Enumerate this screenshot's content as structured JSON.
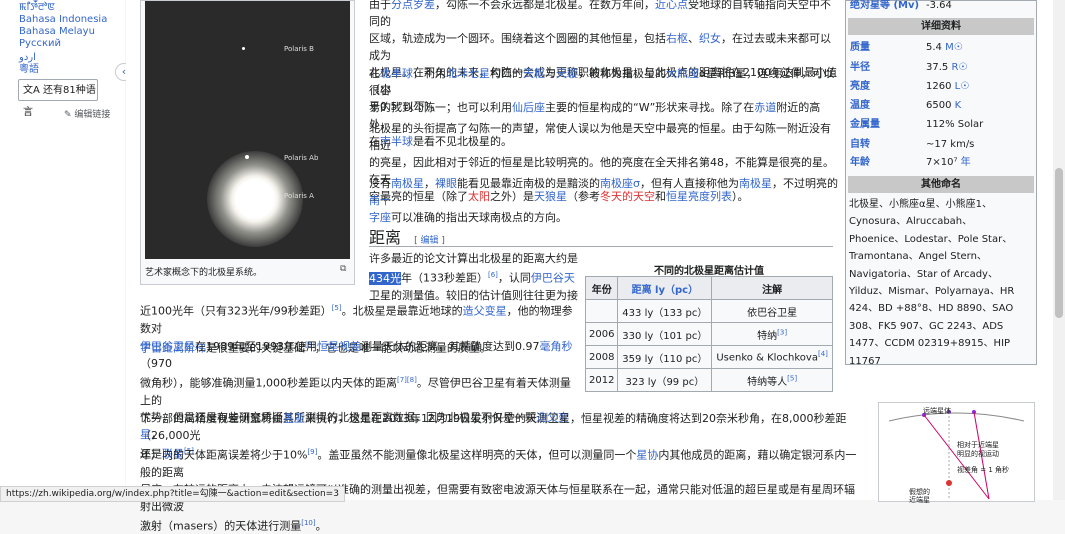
{
  "sidebar": {
    "languages": [
      "ꯃꯤꯇꯩꯂꯣꯟ",
      "Bahasa Indonesia",
      "Bahasa Melayu",
      "Русский",
      "اردو",
      "粵語"
    ],
    "more_languages": "还有81种语言",
    "edit_links": "编辑链接"
  },
  "thumb": {
    "caption": "艺术家概念下的北极星系统。",
    "labels": [
      "Polaris B",
      "Polaris Ab",
      "Polaris A"
    ]
  },
  "paragraphs": {
    "p1": [
      "由于",
      "分点岁差",
      "，勾陈一不会永远都是北极星。在数万年间，",
      "近心点",
      "受地球的自转轴指向天空中不同的",
      "区域，轨迹成为一个圆环。围绕着这个圆圈的其他恒星，包括",
      "右枢",
      "、",
      "织女",
      "，在过去或未来都可以成为",
      "北极星。在不久的未来，勾陈一会成为更称职的北极星，与北极点的距离将在2100年达到最小值（小",
      "于0.5°以下）。"
    ],
    "p2": [
      "在",
      "北半球",
      "，利用",
      "北斗七星",
      "杓口的",
      "天枢",
      "与",
      "天璇",
      "，被称为指极星的",
      "大熊座",
      "α星和β星，连线延伸，可以很容",
      "易的找到勾陈一；也可以利用",
      "仙后座",
      "主要的恒星构成的“W”形状来寻找。除了在",
      "赤道",
      "附近的高处，",
      "在",
      "南半球",
      "是看不见北极星的。"
    ],
    "p3": [
      "北极星的头衔提高了勾陈一的声望，常使人误以为他是天空中最亮的恒星。由于勾陈一附近没有相近",
      "的亮星，因此相对于邻近的恒星是比较明亮的。他的亮度在全天排名第48，不能算是很亮的星。在天",
      "空最亮的恒星（除了",
      "太阳",
      "之外）是",
      "天狼星",
      "（参考",
      "冬天的天空",
      "和",
      "恒星亮度列表",
      "）。"
    ],
    "p4": [
      "没有",
      "南极星",
      "，",
      "裸眼",
      "能看见最靠近南极的是黯淡的",
      "南极座σ",
      "，但有人直接称他为",
      "南极星",
      "，不过明亮的",
      "南十",
      "字座",
      "可以准确的指出天球南极点的方向。"
    ],
    "heading": "距离",
    "heading_edit": "编辑",
    "d1": [
      "许多最近的论文计算出北极星的距离大约是",
      "434光",
      "年（133秒差距）",
      "[6]",
      "，认同",
      "伊巴谷天",
      "卫星的测量值。较旧的估计值则往往更为接"
    ],
    "d2": [
      "近100光年（只有323光年/99秒差距）",
      "[5]",
      "。北极星是最靠近地球的",
      "造父变星",
      "，他的物理参数对",
      "宇宙距离阶梯",
      "是很重要的关键基础",
      "[5]",
      "，它也是唯一能以动态测量的质量。"
    ],
    "d3": [
      "伊巴谷卫星",
      "在1989年至1993年使用",
      "恒星视差",
      "测量天体的距离，其精确度达到0.97",
      "毫角秒",
      "（970",
      "微角秒），能够准确测量1,000秒差距以内天体的距离",
      "[7][8]",
      "。尽管伊巴谷卫星有着天体测量上的",
      "优势，但是还是有些研究质疑其所测得的北极星距离数据，因为北极星不仅是一颗",
      "造父变星",
      "，",
      "还是",
      "联星",
      "[5]"
    ],
    "d4": [
      "下一部的高精度视差测量将由",
      "盖亚",
      "来执行，这是在2013年12月19日发射升空的天测卫星，恒星视差的精确度将达到20奈米秒角，在8,000秒差距（26,000光",
      "年）内的天体距离误差将少于10%",
      "[9]",
      "。盖亚虽然不能测量像北极星这样明亮的天体，但可以测量同一个",
      "星协",
      "内其他成员的距离，藉以确定银河系内一般的距离",
      "尺度。在较远的距离上，电波望远镜可以准确的测量出视差，但需要有致密电波源天体与恒星联系在一起，通常只能对低温的超巨星或是有星周环辐射出微波",
      "激射（masers）的天体进行测量",
      "[10]",
      "。"
    ]
  },
  "table": {
    "caption": "不同的北极星距离估计值",
    "headers": [
      "年份",
      "距离 ly（pc）",
      "注解"
    ],
    "rows": [
      {
        "year": "",
        "dist": "433 ly（133 pc）",
        "note": "依巴谷卫星",
        "ref": ""
      },
      {
        "year": "2006",
        "dist": "330 ly（101 pc）",
        "note": "特纳",
        "ref": "[3]"
      },
      {
        "year": "2008",
        "dist": "359 ly（110 pc）",
        "note": "Usenko & Klochkova",
        "ref": "[4]"
      },
      {
        "year": "2012",
        "dist": "323 ly（99 pc）",
        "note": "特纳等人",
        "ref": "[5]"
      }
    ]
  },
  "infobox": {
    "top_label": "绝对星等 (Mv)",
    "top_value": "-3.64",
    "section_details": "详细资料",
    "rows": [
      {
        "label": "质量",
        "value": "5.4",
        "unit": "M☉"
      },
      {
        "label": "半径",
        "value": "37.5",
        "unit": "R☉"
      },
      {
        "label": "亮度",
        "value": "1260",
        "unit": "L☉"
      },
      {
        "label": "温度",
        "value": "6500",
        "unit": "K"
      },
      {
        "label": "金属量",
        "value": "112% Solar",
        "unit": ""
      },
      {
        "label": "自转",
        "value": "~17 km/s",
        "unit": ""
      },
      {
        "label": "年龄",
        "value": "7×10⁷",
        "unit": "年"
      }
    ],
    "section_names": "其他命名",
    "names": [
      "北极星、小熊座α星、小熊座1、",
      "Cynosura、Alruccabah、",
      "Phoenice、Lodestar、Pole Star、",
      "Tramontana、Angel Stern、",
      "Navigatoria、Star of Arcady、",
      "Yilduz、Mismar、Polyarnaya、HR",
      "424、BD +88°8、HD 8890、SAO",
      "308、FK5 907、GC 2243、ADS",
      "1477、CCDM 02319+8915、HIP",
      "11767"
    ]
  },
  "diagram": {
    "labels": [
      "远端星体",
      "相对于近端星",
      "明显的视运动",
      "视差角 = 1 角秒",
      "假想的",
      "近端星"
    ]
  },
  "status_url": "https://zh.wikipedia.org/w/index.php?title=勾陳一&action=edit&section=3"
}
